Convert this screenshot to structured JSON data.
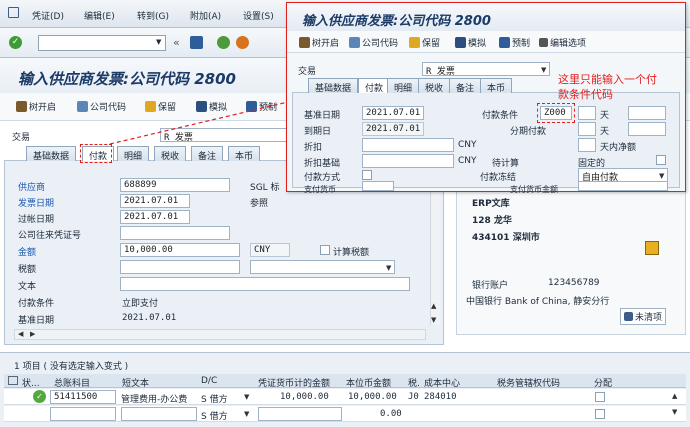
{
  "menu": {
    "items": [
      "凭证(D)",
      "编辑(E)",
      "转到(G)",
      "附加(A)",
      "设置(S)"
    ]
  },
  "main": {
    "title": "输入供应商发票:公司代码 2800",
    "toolbar": {
      "tree": "树开启",
      "company": "公司代码",
      "hold": "保留",
      "simulate": "模拟",
      "preset": "预制"
    },
    "transaction": {
      "label": "交易",
      "value": "R 发票"
    },
    "tabs": [
      "基础数据",
      "付款",
      "明细",
      "税收",
      "备注",
      "本币"
    ],
    "fields": {
      "vendor": {
        "label": "供应商",
        "value": "688899"
      },
      "invoice_date": {
        "label": "发票日期",
        "value": "2021.07.01"
      },
      "posting_date": {
        "label": "过帐日期",
        "value": "2021.07.01"
      },
      "ref": {
        "label": "公司往来凭证号"
      },
      "amount": {
        "label": "金额",
        "value": "10,000.00",
        "currency": "CNY",
        "calc_tax": "计算税额"
      },
      "tax": {
        "label": "税额"
      },
      "text": {
        "label": "文本"
      },
      "terms": {
        "label": "付款条件",
        "value": "立即支付"
      },
      "baseline": {
        "label": "基准日期",
        "value": "2021.07.01"
      },
      "sgl": "SGL 标",
      "ref2": "参照"
    }
  },
  "vendor_info": {
    "name": "ERP文库",
    "street": "128 龙华",
    "city": "434101 深圳市",
    "bank_label": "银行账户",
    "bank_account": "123456789",
    "bank_name": "中国银行 Bank of China, 静安分行",
    "open_items": "未清项"
  },
  "items": {
    "title": "1 项目 ( 没有选定输入变式 )",
    "headers": [
      "状...",
      "总账科目",
      "短文本",
      "D/C",
      "凭证货币计的金额",
      "本位币金额",
      "税.",
      "成本中心",
      "税务管辖权代码",
      "分配"
    ],
    "rows": [
      {
        "account": "51411500",
        "text": "管理费用-办公费",
        "dc": "S 借方",
        "amount": "10,000.00",
        "local": "10,000.00",
        "tax": "J0",
        "cc": "284010"
      },
      {
        "account": "",
        "text": "",
        "dc": "S 借方",
        "amount": "",
        "local": "0.00",
        "tax": "",
        "cc": ""
      }
    ]
  },
  "popup": {
    "title": "输入供应商发票:公司代码 2800",
    "toolbar": {
      "tree": "树开启",
      "company": "公司代码",
      "hold": "保留",
      "simulate": "模拟",
      "preset": "预制",
      "edit": "编辑选项"
    },
    "transaction": {
      "label": "交易",
      "value": "R 发票"
    },
    "tabs": [
      "基础数据",
      "付款",
      "明细",
      "税收",
      "备注",
      "本币"
    ],
    "baseline": {
      "label": "基准日期",
      "value": "2021.07.01"
    },
    "due": {
      "label": "到期日",
      "value": "2021.07.01"
    },
    "discount": "折扣",
    "discount_base": "折扣基础",
    "pay_method": "付款方式",
    "pay_currency": "支付货币",
    "terms": {
      "label": "付款条件",
      "value": "Z000"
    },
    "installment": "分期付款",
    "days1": "天",
    "days2": "天",
    "net": "天内净额",
    "cny1": "CNY",
    "cny2": "CNY",
    "pending": "待计算",
    "fixed": "固定的",
    "block": {
      "label": "付款冻结",
      "value": "自由付款"
    },
    "pay_amount": "支付货币金额"
  },
  "annotation": {
    "line1": "这里只能输入一个付",
    "line2": "款条件代码"
  },
  "colors": {
    "red": "#e0201c",
    "title_blue": "#1b3a66",
    "panel_bg": "#eaf0f6"
  }
}
